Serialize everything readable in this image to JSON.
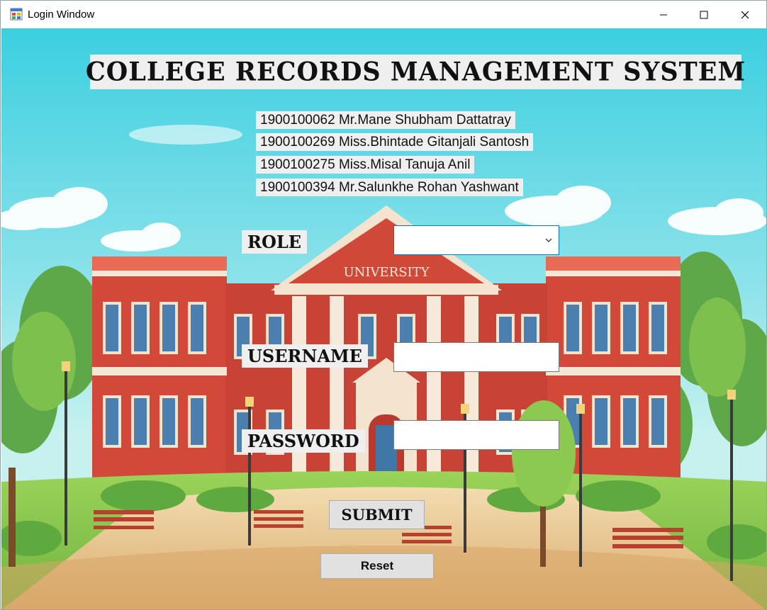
{
  "window": {
    "title": "Login Window",
    "icons": [
      "app-icon",
      "minimize-icon",
      "maximize-icon",
      "close-icon"
    ]
  },
  "header": {
    "title": "COLLEGE RECORDS MANAGEMENT SYSTEM"
  },
  "background": {
    "building_sign": "UNIVERSITY",
    "colors": {
      "sky": "#4fd0e0",
      "building": "#cf4a3a",
      "grass": "#7cbf4a",
      "path": "#e8c89a"
    }
  },
  "members": [
    "1900100062 Mr.Mane Shubham Dattatray",
    "1900100269 Miss.Bhintade Gitanjali Santosh",
    "1900100275 Miss.Misal Tanuja Anil",
    "1900100394 Mr.Salunkhe Rohan Yashwant"
  ],
  "form": {
    "role_label": "ROLE",
    "role_value": "",
    "username_label": "USERNAME",
    "username_value": "",
    "password_label": "PASSWORD",
    "password_value": "",
    "submit_label": "SUBMIT",
    "reset_label": "Reset"
  }
}
